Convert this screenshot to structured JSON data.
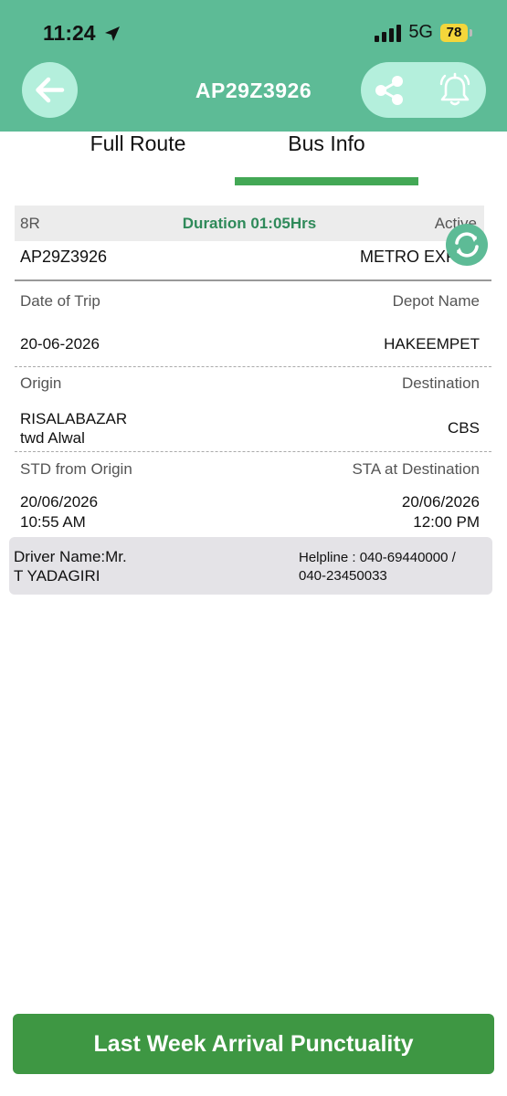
{
  "status_bar": {
    "time": "11:24",
    "network": "5G",
    "battery": "78"
  },
  "header": {
    "title": "AP29Z3926"
  },
  "tabs": [
    {
      "label": "Full Route",
      "active": false
    },
    {
      "label": "Bus Info",
      "active": true
    }
  ],
  "colors": {
    "header": "#5dbb96",
    "accent": "#43a855",
    "button": "#3e9743",
    "duration": "#2f8a5a"
  },
  "bus": {
    "route": "8R",
    "duration": "Duration 01:05Hrs",
    "status": "Active",
    "registration": "AP29Z3926",
    "service_type": "METRO EXPRE"
  },
  "trip": {
    "date_label": "Date of Trip",
    "date_value": "20-06-2026",
    "depot_label": "Depot Name",
    "depot_value": "HAKEEMPET",
    "origin_label": "Origin",
    "origin_line1": "RISALABAZAR",
    "origin_line2": "twd Alwal",
    "destination_label": "Destination",
    "destination_value": "CBS",
    "std_label": "STD from Origin",
    "std_date": "20/06/2026",
    "std_time": "10:55 AM",
    "sta_label": "STA at Destination",
    "sta_date": "20/06/2026",
    "sta_time": "12:00 PM"
  },
  "driver": {
    "line1": "Driver Name:Mr.",
    "line2": "T YADAGIRI",
    "helpline_line1": "Helpline : 040-69440000 /",
    "helpline_line2": "040-23450033"
  },
  "footer": {
    "button_label": "Last Week Arrival Punctuality"
  },
  "icons": {
    "back": "arrow-left-icon",
    "share": "share-icon",
    "alarm": "alarm-bell-icon",
    "refresh": "refresh-icon",
    "location": "location-arrow-icon"
  }
}
